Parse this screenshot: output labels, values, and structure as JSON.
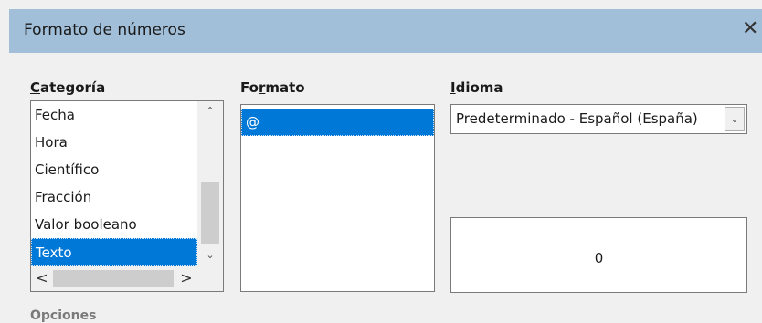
{
  "window": {
    "title": "Formato de números",
    "close_glyph": "✕"
  },
  "categoria": {
    "label_access": "C",
    "label_rest": "ategoría",
    "items": [
      "Fecha",
      "Hora",
      "Científico",
      "Fracción",
      "Valor booleano",
      "Texto"
    ],
    "selected": "Texto",
    "scroll_up_glyph": "⌃",
    "scroll_down_glyph": "⌄",
    "scroll_left_glyph": "<",
    "scroll_right_glyph": ">"
  },
  "formato": {
    "label_before": "Fo",
    "label_access": "r",
    "label_after": "mato",
    "items": [
      "@"
    ],
    "selected": "@"
  },
  "idioma": {
    "label_access": "I",
    "label_rest": "dioma",
    "selected": "Predeterminado - Español (España)",
    "dropdown_glyph": "⌄"
  },
  "preview": {
    "value": "0"
  },
  "opciones": {
    "label": "Opciones"
  },
  "colors": {
    "titlebar": "#a2bfd9",
    "selection": "#0078d7",
    "dialog_bg": "#f0f0f0"
  }
}
